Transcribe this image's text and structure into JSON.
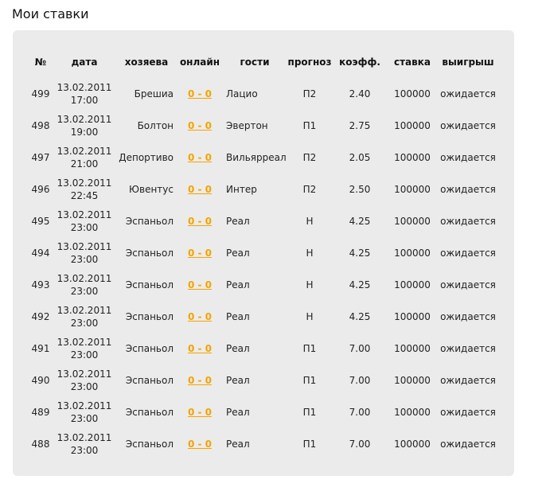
{
  "page": {
    "title": "Мои ставки"
  },
  "table": {
    "headers": {
      "num": "№",
      "date": "дата",
      "home": "хозяева",
      "online": "онлайн",
      "away": "гости",
      "prediction": "прогноз",
      "coef": "коэфф.",
      "stake": "ставка",
      "win": "выигрыш"
    },
    "rows": [
      {
        "num": "499",
        "date": "13.02.2011",
        "time": "17:00",
        "home": "Брешиа",
        "score": "0 - 0",
        "away": "Лацио",
        "prediction": "П2",
        "coef": "2.40",
        "stake": "100000",
        "win": "ожидается"
      },
      {
        "num": "498",
        "date": "13.02.2011",
        "time": "19:00",
        "home": "Болтон",
        "score": "0 - 0",
        "away": "Эвертон",
        "prediction": "П1",
        "coef": "2.75",
        "stake": "100000",
        "win": "ожидается"
      },
      {
        "num": "497",
        "date": "13.02.2011",
        "time": "21:00",
        "home": "Депортиво",
        "score": "0 - 0",
        "away": "Вильярреал",
        "prediction": "П2",
        "coef": "2.05",
        "stake": "100000",
        "win": "ожидается"
      },
      {
        "num": "496",
        "date": "13.02.2011",
        "time": "22:45",
        "home": "Ювентус",
        "score": "0 - 0",
        "away": "Интер",
        "prediction": "П2",
        "coef": "2.50",
        "stake": "100000",
        "win": "ожидается"
      },
      {
        "num": "495",
        "date": "13.02.2011",
        "time": "23:00",
        "home": "Эспаньол",
        "score": "0 - 0",
        "away": "Реал",
        "prediction": "Н",
        "coef": "4.25",
        "stake": "100000",
        "win": "ожидается"
      },
      {
        "num": "494",
        "date": "13.02.2011",
        "time": "23:00",
        "home": "Эспаньол",
        "score": "0 - 0",
        "away": "Реал",
        "prediction": "Н",
        "coef": "4.25",
        "stake": "100000",
        "win": "ожидается"
      },
      {
        "num": "493",
        "date": "13.02.2011",
        "time": "23:00",
        "home": "Эспаньол",
        "score": "0 - 0",
        "away": "Реал",
        "prediction": "Н",
        "coef": "4.25",
        "stake": "100000",
        "win": "ожидается"
      },
      {
        "num": "492",
        "date": "13.02.2011",
        "time": "23:00",
        "home": "Эспаньол",
        "score": "0 - 0",
        "away": "Реал",
        "prediction": "Н",
        "coef": "4.25",
        "stake": "100000",
        "win": "ожидается"
      },
      {
        "num": "491",
        "date": "13.02.2011",
        "time": "23:00",
        "home": "Эспаньол",
        "score": "0 - 0",
        "away": "Реал",
        "prediction": "П1",
        "coef": "7.00",
        "stake": "100000",
        "win": "ожидается"
      },
      {
        "num": "490",
        "date": "13.02.2011",
        "time": "23:00",
        "home": "Эспаньол",
        "score": "0 - 0",
        "away": "Реал",
        "prediction": "П1",
        "coef": "7.00",
        "stake": "100000",
        "win": "ожидается"
      },
      {
        "num": "489",
        "date": "13.02.2011",
        "time": "23:00",
        "home": "Эспаньол",
        "score": "0 - 0",
        "away": "Реал",
        "prediction": "П1",
        "coef": "7.00",
        "stake": "100000",
        "win": "ожидается"
      },
      {
        "num": "488",
        "date": "13.02.2011",
        "time": "23:00",
        "home": "Эспаньол",
        "score": "0 - 0",
        "away": "Реал",
        "prediction": "П1",
        "coef": "7.00",
        "stake": "100000",
        "win": "ожидается"
      }
    ]
  },
  "colors": {
    "panel_background": "#ebebeb",
    "score_link": "#f5a400"
  }
}
